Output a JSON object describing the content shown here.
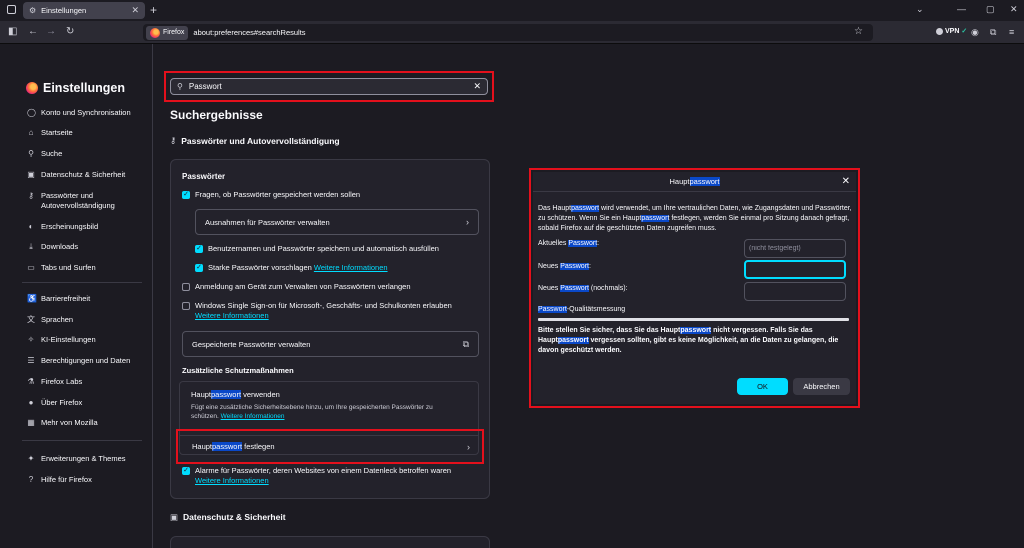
{
  "browser": {
    "tab_title": "Einstellungen",
    "url_chip": "Firefox",
    "url": "about:preferences#searchResults",
    "vpn_label": "VPN"
  },
  "sidebar": {
    "title": "Einstellungen",
    "items": [
      {
        "label": "Konto und Synchronisation",
        "icon": "account-icon"
      },
      {
        "label": "Startseite",
        "icon": "home-icon"
      },
      {
        "label": "Suche",
        "icon": "search-icon"
      },
      {
        "label": "Datenschutz & Sicherheit",
        "icon": "lock-icon"
      },
      {
        "label": "Passwörter und",
        "label2": "Autovervollständigung",
        "icon": "key-icon"
      },
      {
        "label": "Erscheinungsbild",
        "icon": "appearance-icon"
      },
      {
        "label": "Downloads",
        "icon": "download-icon"
      },
      {
        "label": "Tabs und Surfen",
        "icon": "tabs-icon"
      },
      {
        "label": "Barrierefreiheit",
        "icon": "accessibility-icon"
      },
      {
        "label": "Sprachen",
        "icon": "language-icon"
      },
      {
        "label": "KI-Einstellungen",
        "icon": "ai-icon"
      },
      {
        "label": "Berechtigungen und Daten",
        "icon": "permissions-icon"
      },
      {
        "label": "Firefox Labs",
        "icon": "labs-icon"
      },
      {
        "label": "Über Firefox",
        "icon": "firefox-icon"
      },
      {
        "label": "Mehr von Mozilla",
        "icon": "mozilla-icon"
      },
      {
        "label": "Erweiterungen & Themes",
        "icon": "extensions-icon"
      },
      {
        "label": "Hilfe für Firefox",
        "icon": "help-icon"
      }
    ]
  },
  "search": {
    "value": "Passwort"
  },
  "main": {
    "results_heading": "Suchergebnisse",
    "section_title": "Passwörter und Autovervollständigung",
    "card_heading": "Passwörter",
    "ask_save": "Fragen, ob Passwörter gespeichert werden sollen",
    "exceptions_button": "Ausnahmen für Passwörter verwalten",
    "fill_usernames": "Benutzernamen und Passwörter speichern und automatisch ausfüllen",
    "suggest_strong": "Starke Passwörter vorschlagen",
    "more_info": "Weitere Informationen",
    "device_login": "Anmeldung am Gerät zum Verwalten von Passwörtern verlangen",
    "windows_sso": "Windows Single Sign-on für Microsoft-, Geschäfts- und Schulkonten erlauben",
    "manage_saved": "Gespeicherte Passwörter verwalten",
    "extra_protection": "Zusätzliche Schutzmaßnahmen",
    "master_prefix": "Haupt",
    "master_hl": "passwort",
    "master_use_suffix": " verwenden",
    "master_desc": "Fügt eine zusätzliche Sicherheitsebene hinzu, um Ihre gespeicherten Passwörter zu schützen.",
    "master_set_suffix": " festlegen",
    "breach_alerts": "Alarme für Passwörter, deren Websites von einem Datenleck betroffen waren",
    "privacy_section": "Datenschutz & Sicherheit"
  },
  "dialog": {
    "title_prefix": "Haupt",
    "title_hl": "passwort",
    "desc_1": "Das Haupt",
    "desc_hl1": "passwort",
    "desc_2": " wird verwendet, um Ihre vertraulichen Daten, wie Zugangsdaten und Passwörter, zu schützen. Wenn Sie ein Haupt",
    "desc_hl2": "passwort",
    "desc_3": " festlegen, werden Sie einmal pro Sitzung danach gefragt, sobald Firefox auf die geschützten Daten zugreifen muss.",
    "current_prefix": "Aktuelles ",
    "current_hl": "Passwort",
    "current_suffix": ":",
    "current_value": "(nicht festgelegt)",
    "new_prefix": "Neues ",
    "new_hl": "Passwort",
    "new_suffix": ":",
    "repeat_prefix": "Neues ",
    "repeat_hl": "Passwort",
    "repeat_suffix": " (nochmals):",
    "quality_hl": "Passwort",
    "quality_suffix": "-Qualitätsmessung",
    "warn_1": "Bitte stellen Sie sicher, dass Sie das Haupt",
    "warn_hl1": "passwort",
    "warn_2": " nicht vergessen. Falls Sie das Haupt",
    "warn_hl2": "passwort",
    "warn_3": " vergessen sollten, gibt es keine Möglichkeit, an die Daten zu gelangen, die davon geschützt werden.",
    "ok_label": "OK",
    "cancel_label": "Abbrechen"
  }
}
